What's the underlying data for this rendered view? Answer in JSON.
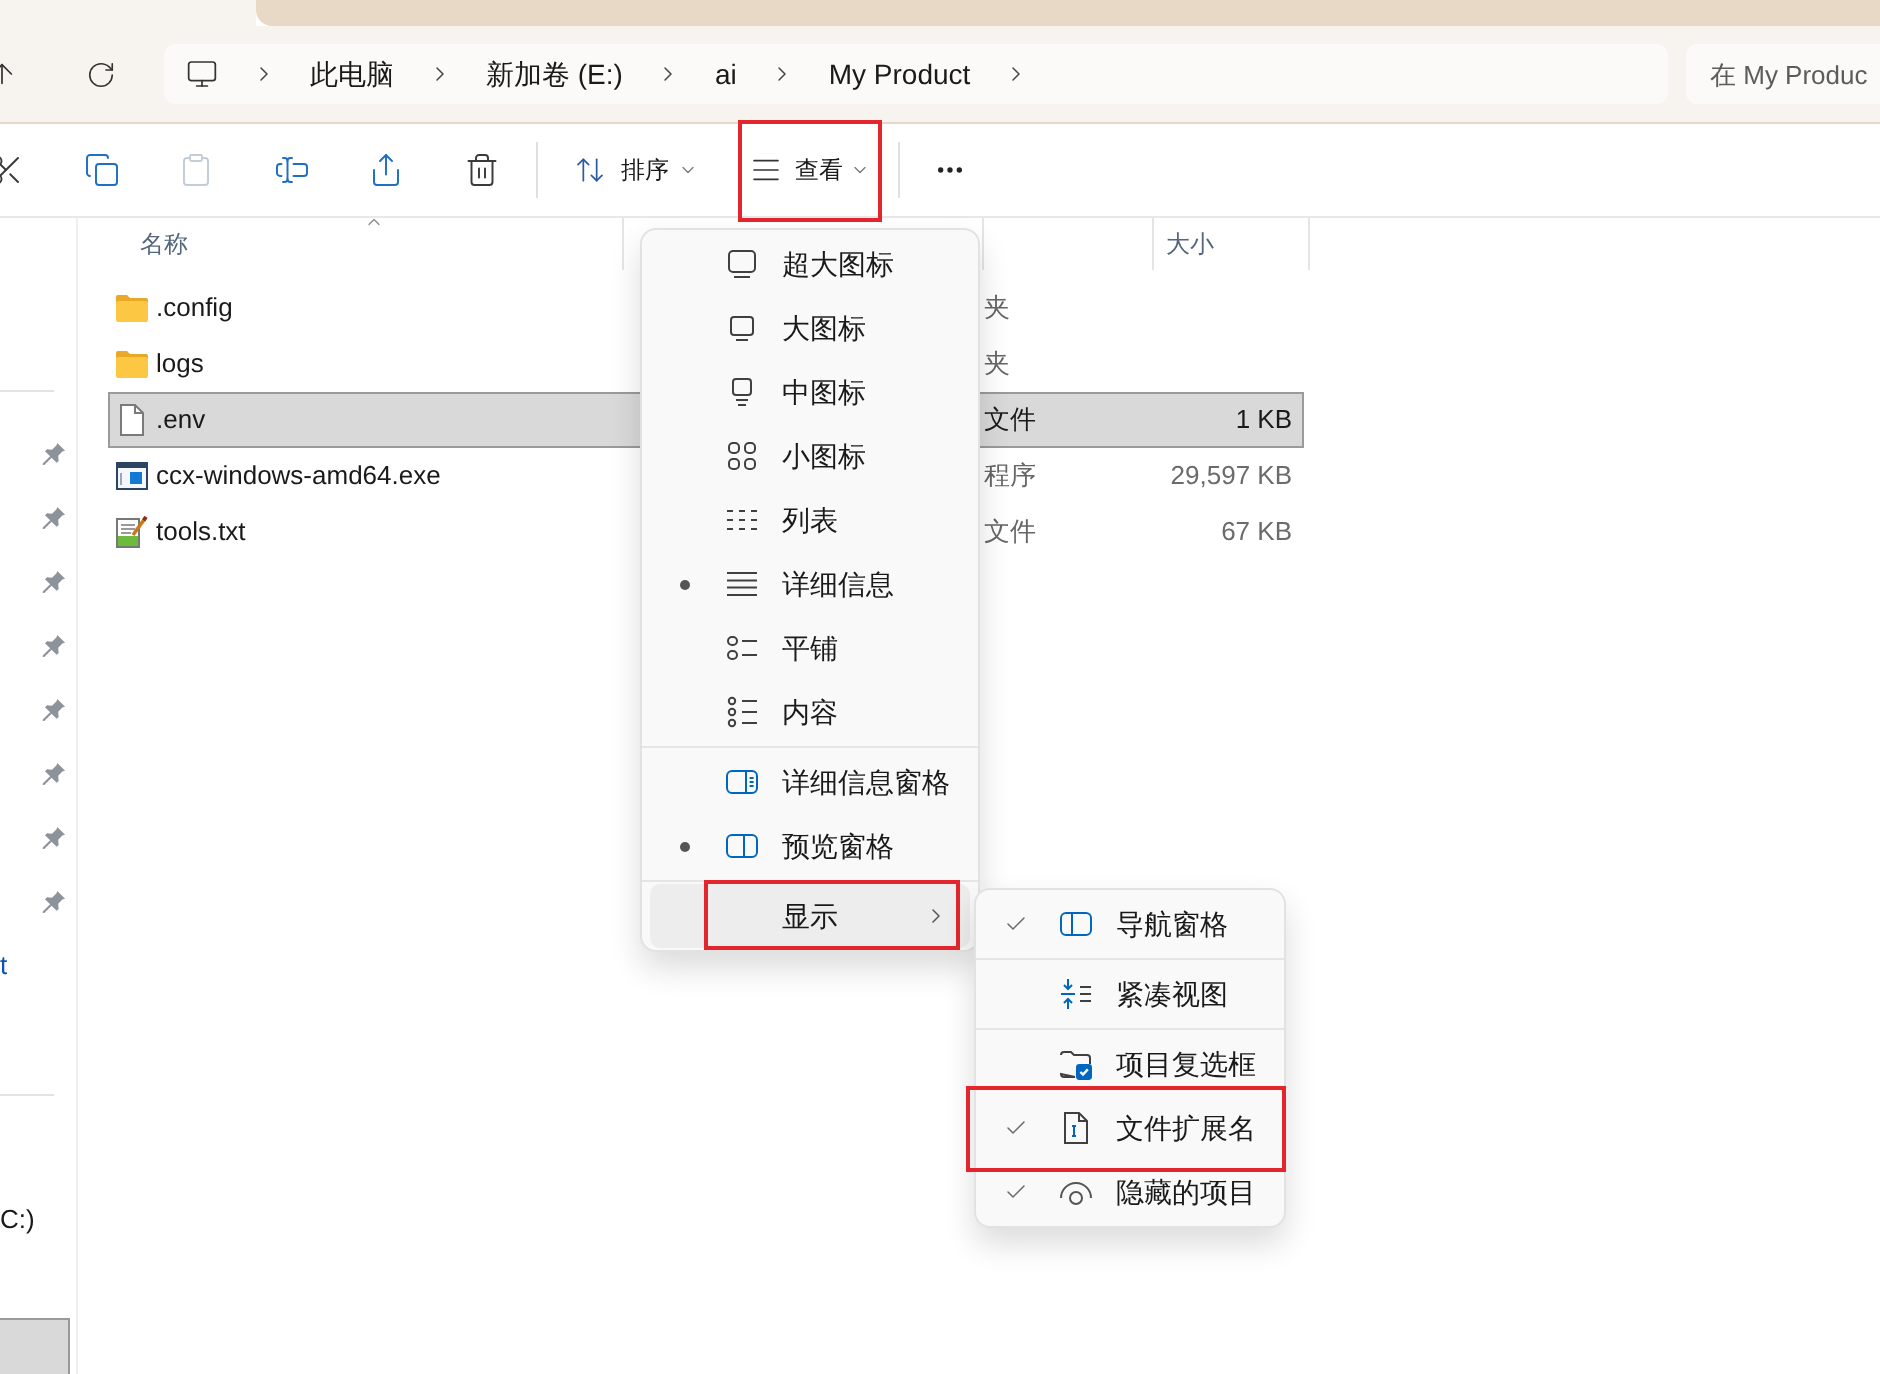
{
  "address_bar": {
    "path": [
      "此电脑",
      "新加卷 (E:)",
      "ai",
      "My Product"
    ]
  },
  "search": {
    "placeholder": "在 My Produc"
  },
  "toolbar": {
    "actions": [
      {
        "kind": "cut",
        "disabled": false
      },
      {
        "kind": "copy",
        "disabled": false
      },
      {
        "kind": "paste",
        "disabled": true
      },
      {
        "kind": "rename",
        "disabled": false
      },
      {
        "kind": "share",
        "disabled": false
      },
      {
        "kind": "delete",
        "disabled": false
      }
    ],
    "sort": {
      "label": "排序"
    },
    "view": {
      "label": "查看",
      "highlighted": true
    }
  },
  "sidebar": {
    "quick_access": [
      {
        "pinned": true,
        "selected": false
      },
      {
        "pinned": true,
        "selected": false
      },
      {
        "pinned": true,
        "selected": false
      },
      {
        "pinned": true,
        "selected": false
      },
      {
        "pinned": true,
        "selected": false
      },
      {
        "pinned": true,
        "selected": false
      },
      {
        "pinned": true,
        "selected": false
      },
      {
        "pinned": true,
        "selected": false
      },
      {
        "label": "t",
        "pinned": false,
        "selected": false
      }
    ],
    "drives": [
      {
        "label": "C:)",
        "selected": false
      },
      {
        "selected": true
      }
    ]
  },
  "table": {
    "columns": [
      {
        "label": "名称",
        "sorted": true
      },
      {
        "label": "大小",
        "sorted": false
      }
    ],
    "rows": [
      {
        "kind": "folder",
        "name": ".config",
        "type": "夹",
        "selected": false
      },
      {
        "kind": "folder",
        "name": "logs",
        "type": "夹",
        "selected": false
      },
      {
        "kind": "file",
        "name": ".env",
        "type": "文件",
        "size": "1 KB",
        "selected": true
      },
      {
        "kind": "program",
        "name": "ccx-windows-amd64.exe",
        "type": "程序",
        "size": "29,597 KB",
        "selected": false
      },
      {
        "kind": "text",
        "name": "tools.txt",
        "type": "文件",
        "size": "67 KB",
        "selected": false
      }
    ]
  },
  "view_menu": {
    "view_modes": [
      {
        "kind": "extralarge",
        "label": "超大图标",
        "selected": false
      },
      {
        "kind": "large",
        "label": "大图标",
        "selected": false
      },
      {
        "kind": "medium",
        "label": "中图标",
        "selected": false
      },
      {
        "kind": "small",
        "label": "小图标",
        "selected": false
      },
      {
        "kind": "list",
        "label": "列表",
        "selected": false
      },
      {
        "kind": "details",
        "label": "详细信息",
        "selected": true
      },
      {
        "kind": "tiles",
        "label": "平铺",
        "selected": false
      },
      {
        "kind": "content",
        "label": "内容",
        "selected": false
      }
    ],
    "panes": [
      {
        "kind": "detailspane",
        "label": "详细信息窗格",
        "selected": false
      },
      {
        "kind": "previewpane",
        "label": "预览窗格",
        "selected": true
      }
    ],
    "show": {
      "label": "显示",
      "expanded": true,
      "highlighted": true
    }
  },
  "show_submenu": {
    "groups": [
      {
        "items": [
          {
            "kind": "navpane",
            "label": "导航窗格",
            "checked": true,
            "highlighted": false
          }
        ]
      },
      {
        "items": [
          {
            "kind": "compact",
            "label": "紧凑视图",
            "checked": false,
            "highlighted": false
          }
        ]
      },
      {
        "items": [
          {
            "kind": "checkboxes",
            "label": "项目复选框",
            "checked": false,
            "highlighted": false
          },
          {
            "kind": "extensions",
            "label": "文件扩展名",
            "checked": true,
            "highlighted": true
          },
          {
            "kind": "hidden",
            "label": "隐藏的项目",
            "checked": true,
            "highlighted": false
          }
        ]
      }
    ]
  }
}
